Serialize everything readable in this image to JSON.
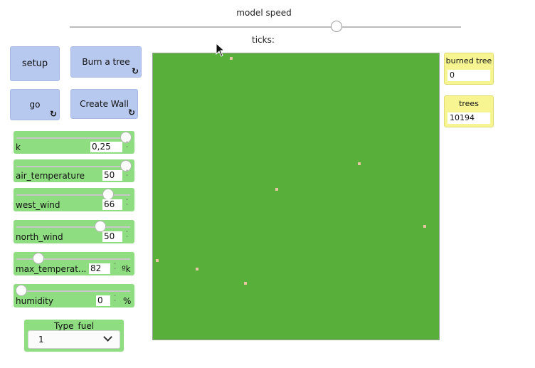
{
  "model_speed": {
    "label": "model speed",
    "value_fraction": 0.68
  },
  "ticks": {
    "label": "ticks:"
  },
  "buttons": {
    "setup": "setup",
    "burn": "Burn a tree",
    "go": "go",
    "wall": "Create Wall",
    "forever_icon": "↻"
  },
  "sliders": [
    {
      "name": "k",
      "value": "0,25",
      "unit": "",
      "level": 1.0
    },
    {
      "name": "air_temperature",
      "value": "50",
      "unit": "",
      "level": 1.0
    },
    {
      "name": "west_wind",
      "value": "66",
      "unit": "",
      "level": 0.83
    },
    {
      "name": "north_wind",
      "value": "50",
      "unit": "",
      "level": 0.75
    },
    {
      "name": "max_temperat...",
      "value": "82",
      "unit": "ºk",
      "level": 0.2
    },
    {
      "name": "humidity",
      "value": "0",
      "unit": "%",
      "level": 0.0
    }
  ],
  "chooser": {
    "label": "Type_fuel",
    "selected": "1"
  },
  "monitors": {
    "burned": {
      "label": "burned tree",
      "value": "0"
    },
    "trees": {
      "label": "trees",
      "value": "10194"
    }
  },
  "colors": {
    "forest": "#58b03a",
    "spot": "#e8c6a3",
    "button": "#b8c9ef",
    "slider": "#8fdd81",
    "monitor": "#f7f592"
  }
}
